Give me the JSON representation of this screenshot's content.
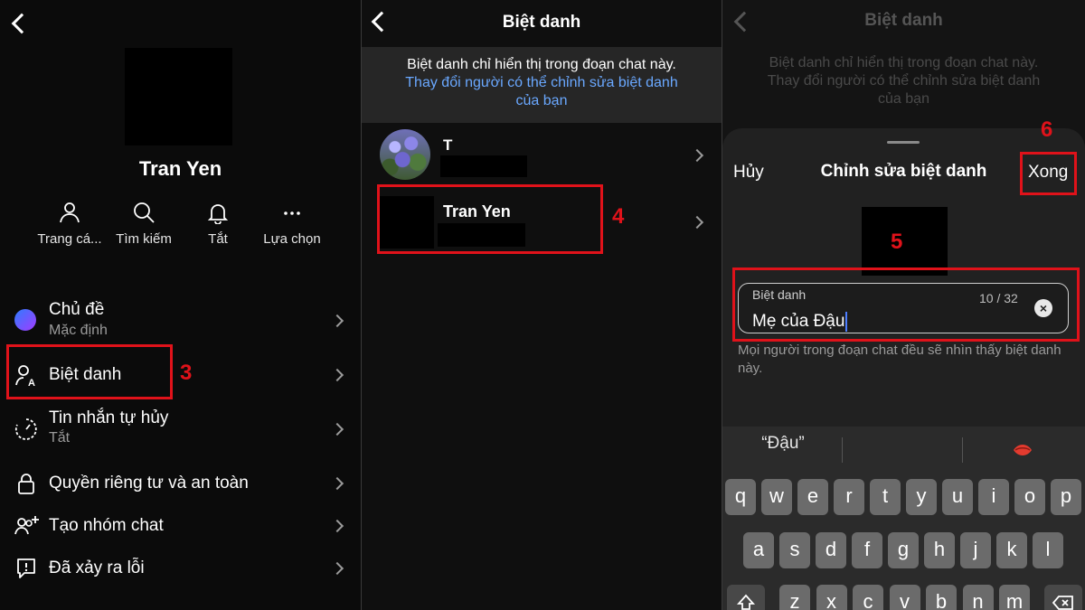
{
  "panel1": {
    "profile_name": "Tran Yen",
    "quick_actions": [
      {
        "label": "Trang cá...",
        "icon": "person-icon"
      },
      {
        "label": "Tìm kiếm",
        "icon": "search-icon"
      },
      {
        "label": "Tắt",
        "icon": "bell-icon"
      },
      {
        "label": "Lựa chọn",
        "icon": "more-icon"
      }
    ],
    "menu": [
      {
        "title": "Chủ đề",
        "subtitle": "Mặc định",
        "icon": "theme-gradient-icon"
      },
      {
        "title": "Biệt danh",
        "icon": "nickname-icon"
      },
      {
        "title": "Tin nhắn tự hủy",
        "subtitle": "Tắt",
        "icon": "timer-icon"
      },
      {
        "title": "Quyền riêng tư và an toàn",
        "icon": "lock-icon"
      },
      {
        "title": "Tạo nhóm chat",
        "icon": "add-group-icon"
      },
      {
        "title": "Đã xảy ra lỗi",
        "icon": "report-icon"
      }
    ],
    "step": "3"
  },
  "panel2": {
    "title": "Biệt danh",
    "info": "Biệt danh chỉ hiển thị trong đoạn chat này.",
    "link": "Thay đổi người có thể chỉnh sửa biệt danh của bạn",
    "members": [
      {
        "name": "T"
      },
      {
        "name": "Tran Yen"
      }
    ],
    "step": "4"
  },
  "panel3": {
    "bg_title": "Biệt danh",
    "bg_info": "Biệt danh chỉ hiển thị trong đoạn chat này.",
    "bg_link": "Thay đổi người có thể chỉnh sửa biệt danh của bạn",
    "cancel": "Hủy",
    "sheet_title": "Chỉnh sửa biệt danh",
    "done": "Xong",
    "field_label": "Biệt danh",
    "field_count": "10 / 32",
    "field_value": "Mẹ của Đậu",
    "hint": "Mọi người trong đoạn chat đều sẽ nhìn thấy biệt danh này.",
    "suggestion": "“Đậu”",
    "step_field": "5",
    "step_done": "6",
    "keys_row1": [
      "q",
      "w",
      "e",
      "r",
      "t",
      "y",
      "u",
      "i",
      "o",
      "p"
    ],
    "keys_row2": [
      "a",
      "s",
      "d",
      "f",
      "g",
      "h",
      "j",
      "k",
      "l"
    ],
    "keys_row3": [
      "z",
      "x",
      "c",
      "v",
      "b",
      "n",
      "m"
    ]
  },
  "colors": {
    "accent_red": "#e0121a",
    "link_blue": "#6aa8ff"
  }
}
